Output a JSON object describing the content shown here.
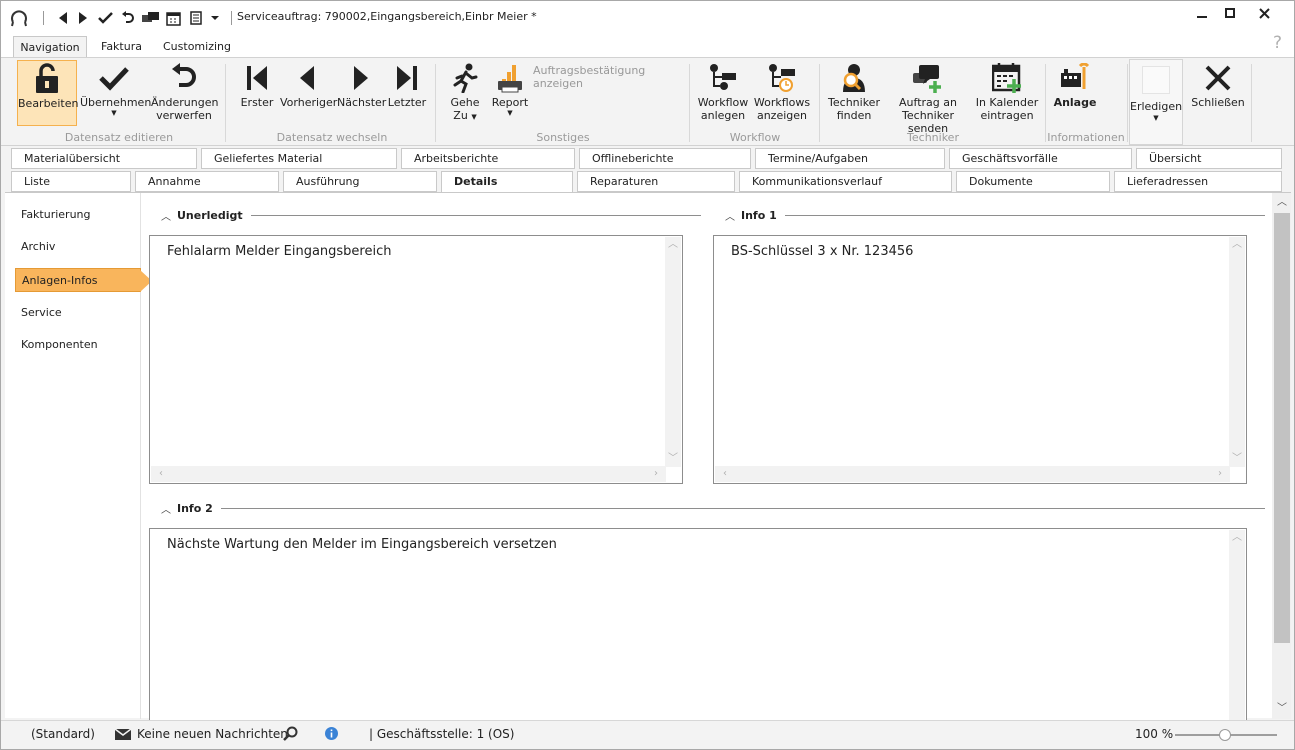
{
  "window": {
    "title": "Serviceauftrag: 790002,Eingangsbereich,Einbr Meier *"
  },
  "menu_tabs": [
    "Navigation",
    "Faktura",
    "Customizing"
  ],
  "help_label": "?",
  "ribbon": {
    "buttons": {
      "bearbeiten": "Bearbeiten",
      "uebernehmen": "Übernehmen",
      "aenderungen_1": "Änderungen",
      "aenderungen_2": "verwerfen",
      "erster": "Erster",
      "vorheriger": "Vorheriger",
      "naechster": "Nächster",
      "letzter": "Letzter",
      "gehe_1": "Gehe",
      "gehe_2": "Zu",
      "report": "Report",
      "auftragsbestaetigung": "Auftragsbestätigung anzeigen",
      "workflow_anlegen_1": "Workflow",
      "workflow_anlegen_2": "anlegen",
      "workflows_anzeigen_1": "Workflows",
      "workflows_anzeigen_2": "anzeigen",
      "techniker_finden_1": "Techniker",
      "techniker_finden_2": "finden",
      "auftrag_senden_1": "Auftrag an",
      "auftrag_senden_2": "Techniker senden",
      "kalender_1": "In Kalender",
      "kalender_2": "eintragen",
      "anlage": "Anlage",
      "erledigen": "Erledigen",
      "schliessen": "Schließen"
    },
    "groups": {
      "datensatz_editieren": "Datensatz editieren",
      "datensatz_wechseln": "Datensatz wechseln",
      "sonstiges": "Sonstiges",
      "workflow": "Workflow",
      "techniker": "Techniker",
      "informationen": "Informationen"
    }
  },
  "tabs_row1": [
    "Materialübersicht",
    "Geliefertes Material",
    "Arbeitsberichte",
    "Offlineberichte",
    "Termine/Aufgaben",
    "Geschäftsvorfälle",
    "Übersicht"
  ],
  "tabs_row2": [
    "Liste",
    "Annahme",
    "Ausführung",
    "Details",
    "Reparaturen",
    "Kommunikationsverlauf",
    "Dokumente",
    "Lieferadressen"
  ],
  "left_nav": [
    "Fakturierung",
    "Archiv",
    "Anlagen-Infos",
    "Service",
    "Komponenten"
  ],
  "sections": {
    "unerledigt": {
      "title": "Unerledigt",
      "text": "Fehlalarm Melder Eingangsbereich"
    },
    "info1": {
      "title": "Info 1",
      "text": "BS-Schlüssel 3 x Nr. 123456"
    },
    "info2": {
      "title": "Info 2",
      "text": "Nächste Wartung den Melder im Eingangsbereich versetzen"
    }
  },
  "statusbar": {
    "mode": "(Standard)",
    "messages": "Keine neuen Nachrichten",
    "branch": "| Geschäftsstelle:  1 (OS)",
    "zoom": "100 %"
  },
  "colors": {
    "accent": "#f9b55c",
    "highlight": "#fde4b8",
    "info_blue": "#3b83d6",
    "green": "#4caf50"
  }
}
